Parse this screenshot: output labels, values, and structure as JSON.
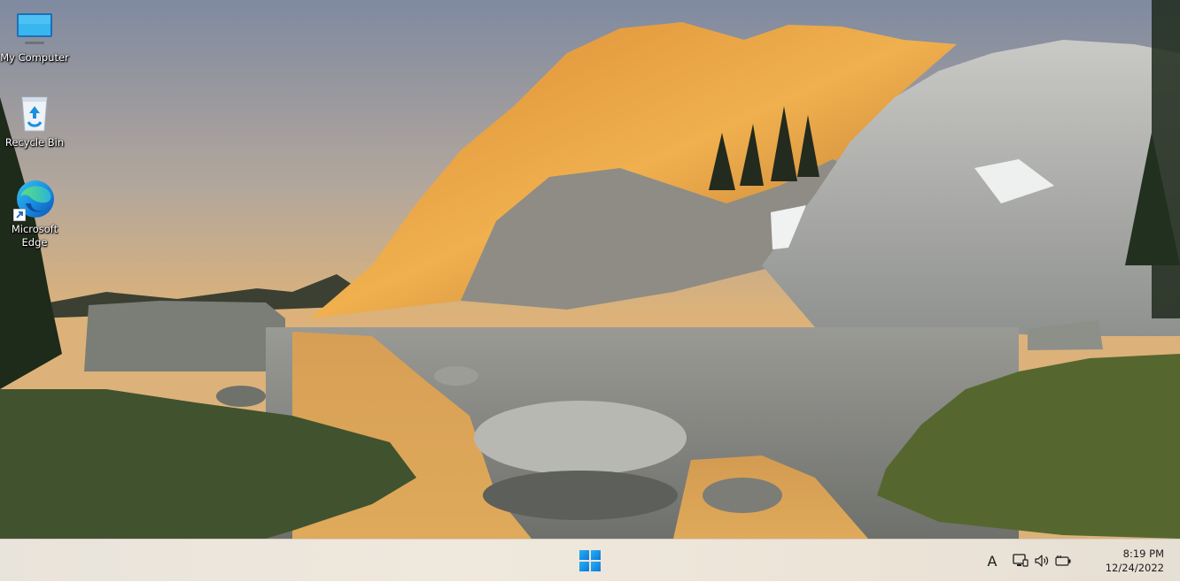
{
  "desktop": {
    "icons": [
      {
        "label": "My Computer",
        "icon": "monitor-icon"
      },
      {
        "label": "Recycle Bin",
        "icon": "recycle-bin-icon"
      },
      {
        "label": "Microsoft\nEdge",
        "icon": "edge-icon",
        "shortcut": true
      }
    ]
  },
  "taskbar": {
    "start_icon": "windows-logo-icon",
    "tray": {
      "ime_label": "A",
      "icons": [
        "network-icon",
        "volume-icon",
        "battery-icon"
      ],
      "time": "8:19 PM",
      "date": "12/24/2022"
    },
    "colors": {
      "background": "#ece6dc",
      "start_accent": "#1a8cf0"
    }
  }
}
